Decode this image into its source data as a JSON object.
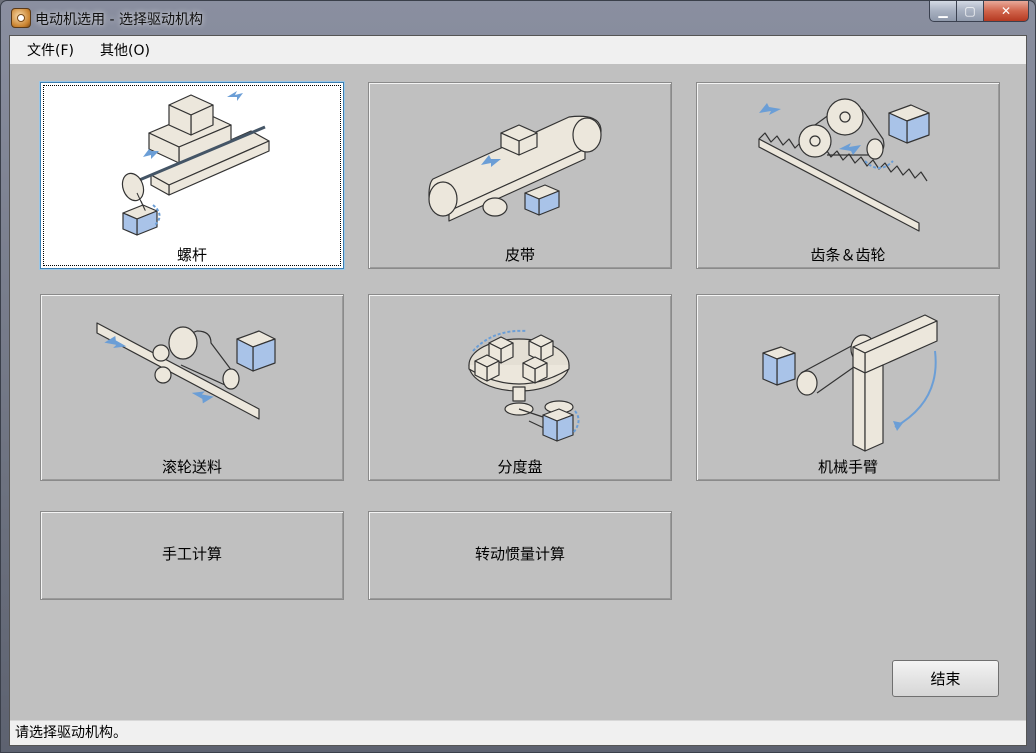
{
  "window": {
    "title": "电动机选用 - 选择驱动机构"
  },
  "menubar": {
    "items": [
      {
        "label": "文件(F)"
      },
      {
        "label": "其他(O)"
      }
    ]
  },
  "mechanisms": [
    {
      "label": "螺杆",
      "icon": "ball-screw-icon",
      "selected": true
    },
    {
      "label": "皮带",
      "icon": "belt-conveyor-icon"
    },
    {
      "label": "齿条＆齿轮",
      "icon": "rack-and-pinion-icon"
    },
    {
      "label": "滚轮送料",
      "icon": "roller-feed-icon"
    },
    {
      "label": "分度盘",
      "icon": "index-table-icon"
    },
    {
      "label": "机械手臂",
      "icon": "robot-arm-icon"
    },
    {
      "label": "手工计算"
    },
    {
      "label": "转动惯量计算"
    }
  ],
  "buttons": {
    "end_label": "结束"
  },
  "status": {
    "text": "请选择驱动机构。"
  },
  "colors": {
    "accent_blue": "#6b9ed6",
    "part_fill": "#ece7dc",
    "motor_blue": "#a9c3e8"
  }
}
